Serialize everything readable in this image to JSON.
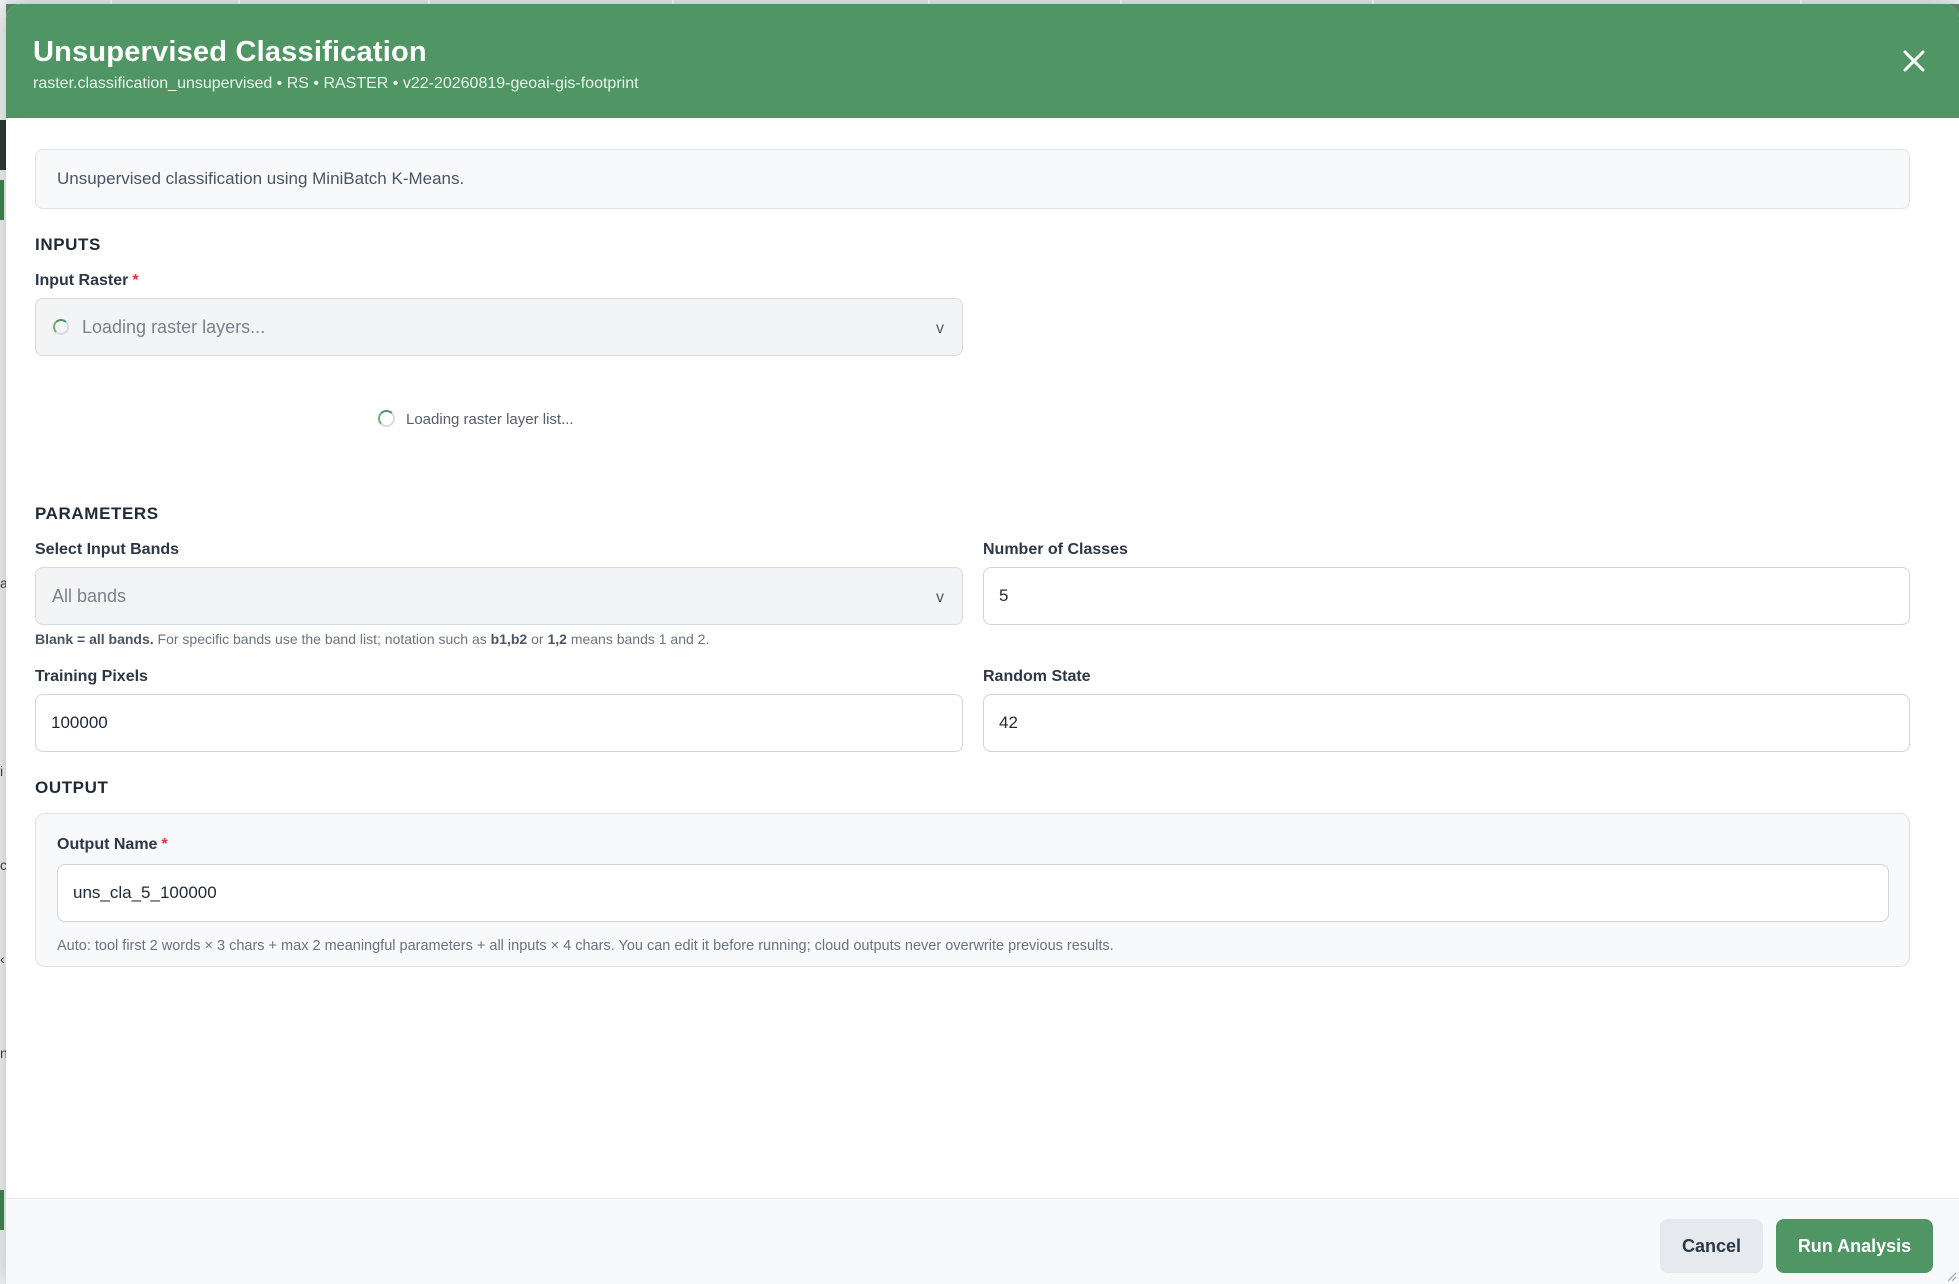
{
  "dialog": {
    "title": "Unsupervised Classification",
    "subtitle": "raster.classification_unsupervised • RS • RASTER • v22-20260819-geoai-gis-footprint",
    "close_icon": "close-icon",
    "description": "Unsupervised classification using MiniBatch K-Means."
  },
  "inputs": {
    "section_title": "INPUTS",
    "raster": {
      "label": "Input Raster",
      "required_mark": "*",
      "placeholder": "Loading raster layers...",
      "chevron": "v",
      "loading_text": "Loading raster layer list..."
    }
  },
  "parameters": {
    "section_title": "PARAMETERS",
    "bands": {
      "label": "Select Input Bands",
      "value": "All bands",
      "chevron": "v",
      "hint_bold_1": "Blank = all bands.",
      "hint_text_1": "For specific bands use the band list; notation such as",
      "hint_bold_2": "b1,b2",
      "hint_text_2": "or",
      "hint_bold_3": "1,2",
      "hint_text_3": "means bands 1 and 2."
    },
    "num_classes": {
      "label": "Number of Classes",
      "value": "5"
    },
    "training_pixels": {
      "label": "Training Pixels",
      "value": "100000"
    },
    "random_state": {
      "label": "Random State",
      "value": "42"
    }
  },
  "output": {
    "section_title": "OUTPUT",
    "name": {
      "label": "Output Name",
      "required_mark": "*",
      "value": "uns_cla_5_100000",
      "hint": "Auto: tool first 2 words × 3 chars + max 2 meaningful parameters + all inputs × 4 chars. You can edit it before running; cloud outputs never overwrite previous results."
    }
  },
  "footer": {
    "cancel_label": "Cancel",
    "run_label": "Run Analysis"
  },
  "colors": {
    "header_green": "#4f9664",
    "required_red": "#d9363e",
    "backdrop": "#5c8f68"
  }
}
